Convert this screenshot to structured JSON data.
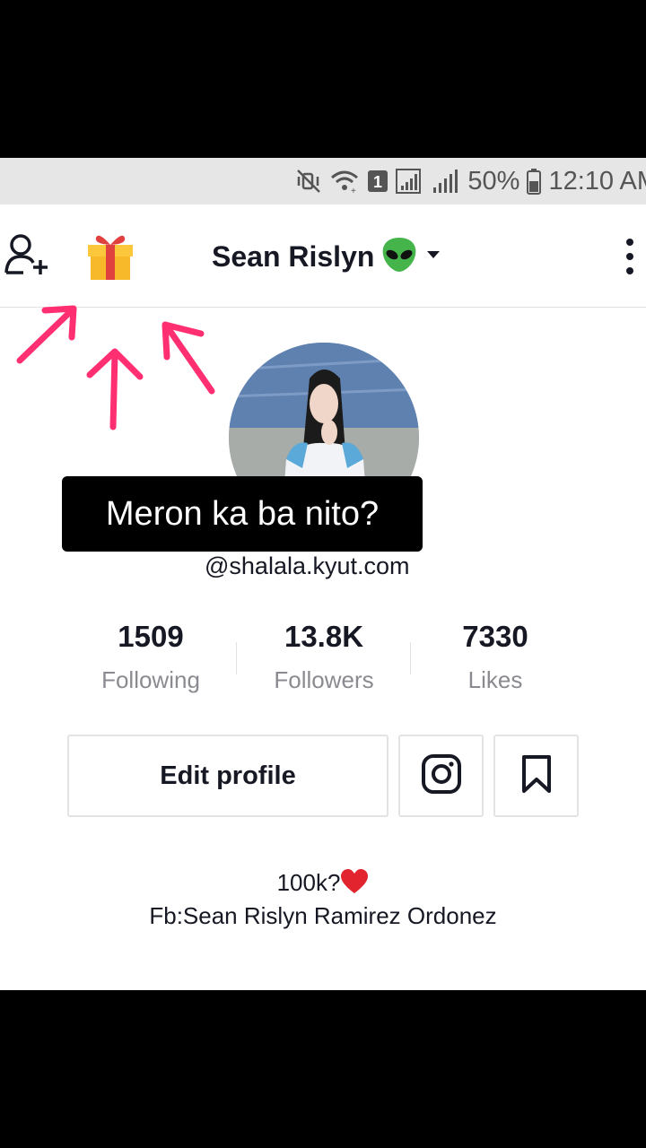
{
  "status_bar": {
    "battery_text": "50%",
    "time": "12:10 AM",
    "icons": [
      "mute-vibrate-icon",
      "wifi-icon",
      "sim-badge-icon",
      "signal-icon",
      "signal-icon",
      "battery-icon"
    ],
    "sim_label": "1"
  },
  "header": {
    "username": "Sean Rislyn",
    "username_emoji": "alien-emoji",
    "icons": [
      "add-friend-icon",
      "gift-icon",
      "chevron-down-icon",
      "more-vert-icon"
    ]
  },
  "overlay": {
    "caption": "Meron ka ba nito?",
    "arrow_color": "#ff2f72"
  },
  "profile": {
    "handle": "@shalala.kyut.com",
    "stats": [
      {
        "value": "1509",
        "label": "Following"
      },
      {
        "value": "13.8K",
        "label": "Followers"
      },
      {
        "value": "7330",
        "label": "Likes"
      }
    ],
    "edit_profile_label": "Edit profile",
    "bio_line_1": "100k?",
    "bio_line_1_emoji": "heart-emoji",
    "bio_line_2": "Fb:Sean Rislyn Ramirez Ordonez"
  }
}
